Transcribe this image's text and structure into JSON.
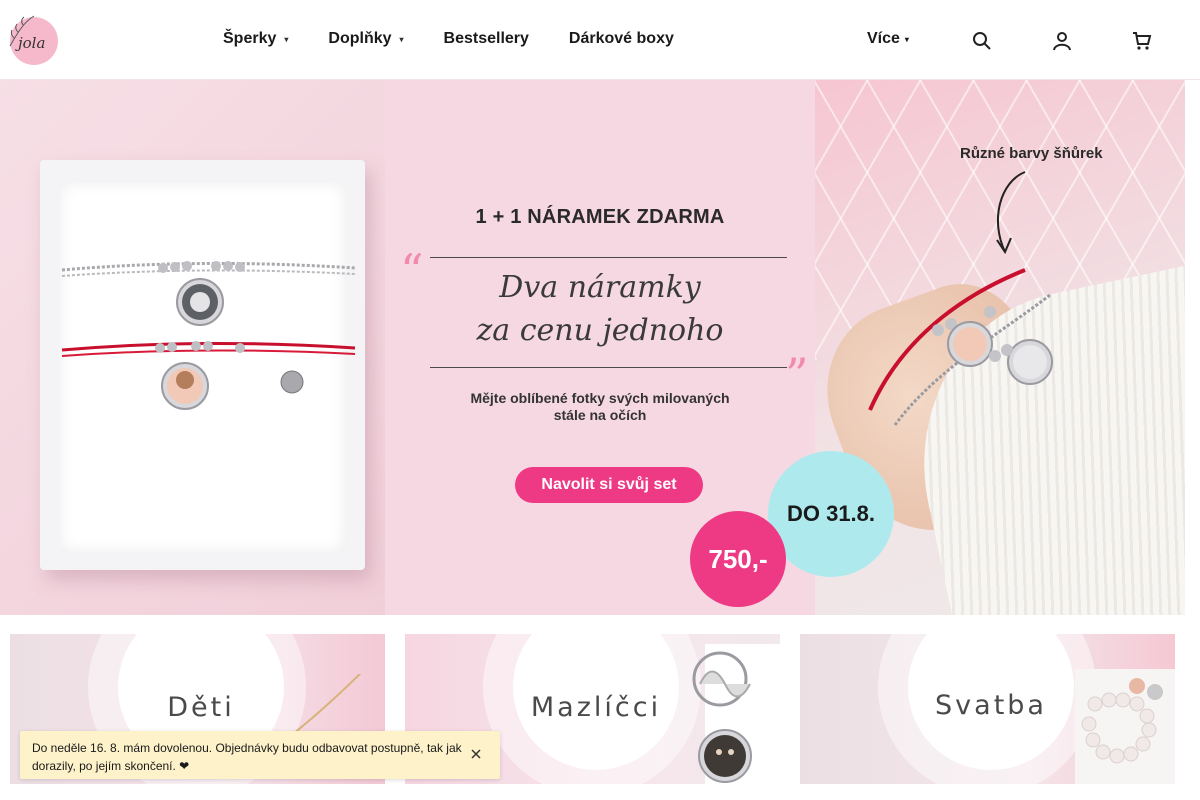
{
  "header": {
    "logo_alt": "Jola",
    "nav": [
      {
        "label": "Šperky",
        "has_dropdown": true
      },
      {
        "label": "Doplňky",
        "has_dropdown": true
      },
      {
        "label": "Bestsellery",
        "has_dropdown": false
      },
      {
        "label": "Dárkové boxy",
        "has_dropdown": false
      }
    ],
    "more_label": "Více",
    "icons": [
      "search-icon",
      "user-icon",
      "cart-icon"
    ]
  },
  "hero": {
    "title": "1 + 1 NÁRAMEK ZDARMA",
    "script_line1": "Dva náramky",
    "script_line2": "za cenu jednoho",
    "subtitle_line1": "Mějte oblíbené fotky svých milovaných",
    "subtitle_line2": "stále na očích",
    "cta_label": "Navolit si svůj set",
    "deadline": "DO 31.8.",
    "price": "750,-",
    "cord_label": "Různé barvy šňůrek",
    "colors": {
      "accent": "#ee3a85",
      "cyan": "#aeeaed",
      "banner_bg": "#f6d8e2"
    }
  },
  "categories": [
    {
      "label": "Děti"
    },
    {
      "label": "Mazlíčci"
    },
    {
      "label": "Svatba"
    }
  ],
  "notice": {
    "text": "Do neděle 16. 8. mám dovolenou. Objednávky budu odbavovat postupně, tak jak dorazily, po jejím skončení. ❤"
  }
}
